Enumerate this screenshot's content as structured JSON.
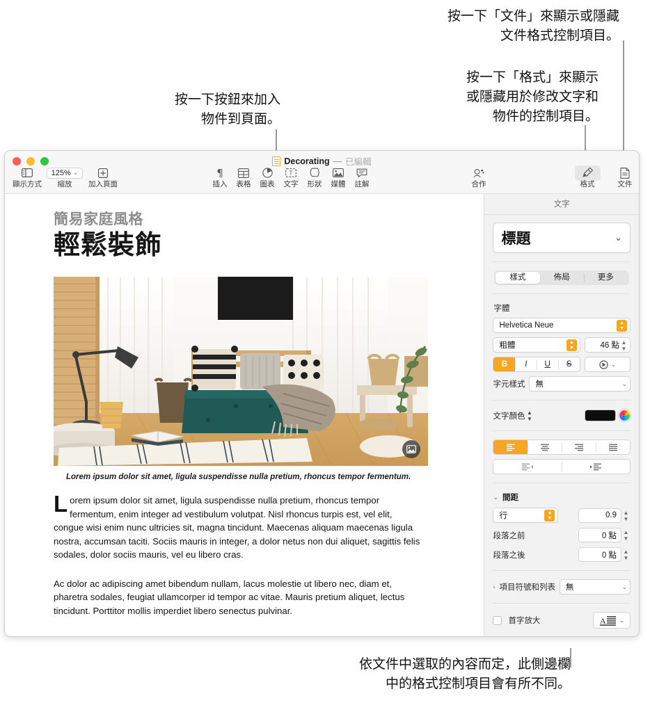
{
  "callouts": {
    "top_left": "按一下按鈕來加入\n物件到頁面。",
    "top_right": "按一下「文件」來顯示或隱藏\n文件格式控制項目。",
    "mid_right": "按一下「格式」來顯示\n或隱藏用於修改文字和\n物件的控制項目。",
    "bottom": "依文件中選取的內容而定，此側邊欄\n中的格式控制項目會有所不同。"
  },
  "window": {
    "title": "Decorating",
    "title_dash": "—",
    "edited_status": "已編輯"
  },
  "toolbar": {
    "left_items": [
      {
        "label": "顯示方式",
        "icon": "sidebar-view-icon"
      },
      {
        "label": "縮放",
        "icon": "zoom-icon",
        "value": "125%"
      },
      {
        "label": "加入頁面",
        "icon": "add-page-icon"
      }
    ],
    "center_items": [
      {
        "label": "插入",
        "icon": "paragraph-insert-icon"
      },
      {
        "label": "表格",
        "icon": "table-icon"
      },
      {
        "label": "圖表",
        "icon": "chart-icon"
      },
      {
        "label": "文字",
        "icon": "text-box-icon"
      },
      {
        "label": "形狀",
        "icon": "shape-icon"
      },
      {
        "label": "媒體",
        "icon": "media-icon"
      },
      {
        "label": "註解",
        "icon": "comment-icon"
      }
    ],
    "right_items": [
      {
        "label": "合作",
        "icon": "collaborate-icon",
        "selected": false
      },
      {
        "label": "格式",
        "icon": "format-brush-icon",
        "selected": true
      },
      {
        "label": "文件",
        "icon": "document-icon",
        "selected": false
      }
    ]
  },
  "document": {
    "eyebrow": "簡易家庭風格",
    "headline": "輕鬆裝飾",
    "image_caption": "Lorem ipsum dolor sit amet, ligula suspendisse nulla pretium, rhoncus tempor fermentum.",
    "dropcap": "L",
    "paragraph_1": "orem ipsum dolor sit amet, ligula suspendisse nulla pretium, rhoncus tempor fermentum, enim integer ad vestibulum volutpat. Nisl rhoncus turpis est, vel elit, congue wisi enim nunc ultricies sit, magna tincidunt. Maecenas aliquam maecenas ligula nostra, accumsan taciti. Sociis mauris in integer, a dolor netus non dui aliquet, sagittis felis sodales, dolor sociis mauris, vel eu libero cras.",
    "paragraph_2": "Ac dolor ac adipiscing amet bibendum nullam, lacus molestie ut libero nec, diam et, pharetra sodales, feugiat ullamcorper id tempor ac vitae. Mauris pretium aliquet, lectus tincidunt. Porttitor mollis imperdiet libero senectus pulvinar."
  },
  "sidebar": {
    "panel_title": "文字",
    "paragraph_style": "標題",
    "tabs": [
      {
        "label": "樣式",
        "selected": true
      },
      {
        "label": "佈局",
        "selected": false
      },
      {
        "label": "更多",
        "selected": false
      }
    ],
    "font_section": {
      "label": "字體",
      "family": "Helvetica Neue",
      "weight": "粗體",
      "size": "46 點",
      "bold": "B",
      "italic": "I",
      "underline": "U",
      "strikethrough": "S",
      "bold_active": true,
      "char_style_label": "字元樣式",
      "char_style_value": "無"
    },
    "text_color": {
      "label": "文字顏色",
      "color": "#0d0d0d"
    },
    "alignment": {
      "items": [
        "align-left-icon",
        "align-center-icon",
        "align-right-icon",
        "align-justify-icon"
      ],
      "active_index": 0,
      "indent_items": [
        "outdent-icon",
        "indent-icon"
      ]
    },
    "spacing": {
      "title": "間距",
      "mode": "行",
      "line_value": "0.9",
      "before_label": "段落之前",
      "before_value": "0 點",
      "after_label": "段落之後",
      "after_value": "0 點"
    },
    "bullets": {
      "label": "項目符號和列表",
      "value": "無"
    },
    "dropcap": {
      "label": "首字放大",
      "checked": false,
      "preview": "A"
    }
  },
  "colors": {
    "accent": "#f5a623",
    "sidebar_bg": "#f2f2f2",
    "toolbar_bg": "#f7f7f7"
  }
}
